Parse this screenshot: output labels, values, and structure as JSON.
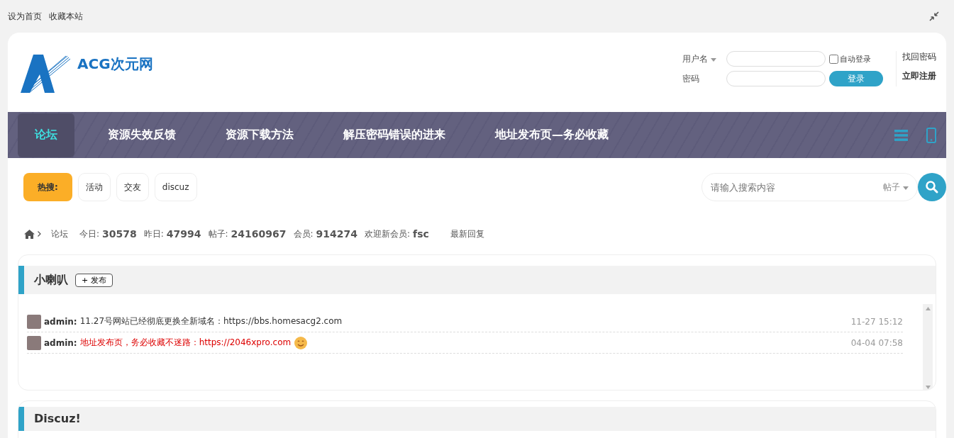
{
  "topbar": {
    "links": [
      "设为首页",
      "收藏本站"
    ]
  },
  "logo": {
    "text": "ACG次元网"
  },
  "login": {
    "username_label": "用户名",
    "password_label": "密码",
    "auto_login": {
      "label": "自动登录",
      "checked": false
    },
    "submit": "登录",
    "forgot": "找回密码",
    "register": "立即注册"
  },
  "nav": {
    "items": [
      {
        "label": "论坛",
        "selected": true
      },
      {
        "label": "资源失效反馈",
        "selected": false
      },
      {
        "label": "资源下载方法",
        "selected": false
      },
      {
        "label": "解压密码错误的进来",
        "selected": false
      },
      {
        "label": "地址发布页—务必收藏",
        "selected": false
      }
    ]
  },
  "hot_search": {
    "label": "热搜:",
    "tags": [
      "活动",
      "交友",
      "discuz"
    ]
  },
  "search": {
    "placeholder": "请输入搜索内容",
    "scope": "帖子"
  },
  "breadcrumb": {
    "current": "论坛",
    "stats": [
      {
        "label": "今日:",
        "value": "30578"
      },
      {
        "label": "昨日:",
        "value": "47994"
      },
      {
        "label": "帖子:",
        "value": "24160967"
      },
      {
        "label": "会员:",
        "value": "914274"
      },
      {
        "label": "欢迎新会员:",
        "value": "fsc"
      }
    ],
    "latest": "最新回复"
  },
  "announcements": {
    "title": "小喇叭",
    "post_button": "+ 发布",
    "items": [
      {
        "author": "admin:",
        "text": "11.27号网站已经彻底更换全新域名：https://bbs.homesacg2.com",
        "time": "11-27 15:12",
        "color": "#333333",
        "emoji": false
      },
      {
        "author": "admin:",
        "text": "地址发布页，务必收藏不迷路：https://2046xpro.com",
        "time": "04-04 07:58",
        "color": "#dd0000",
        "emoji": true
      }
    ]
  },
  "section": {
    "title": "Discuz!"
  }
}
